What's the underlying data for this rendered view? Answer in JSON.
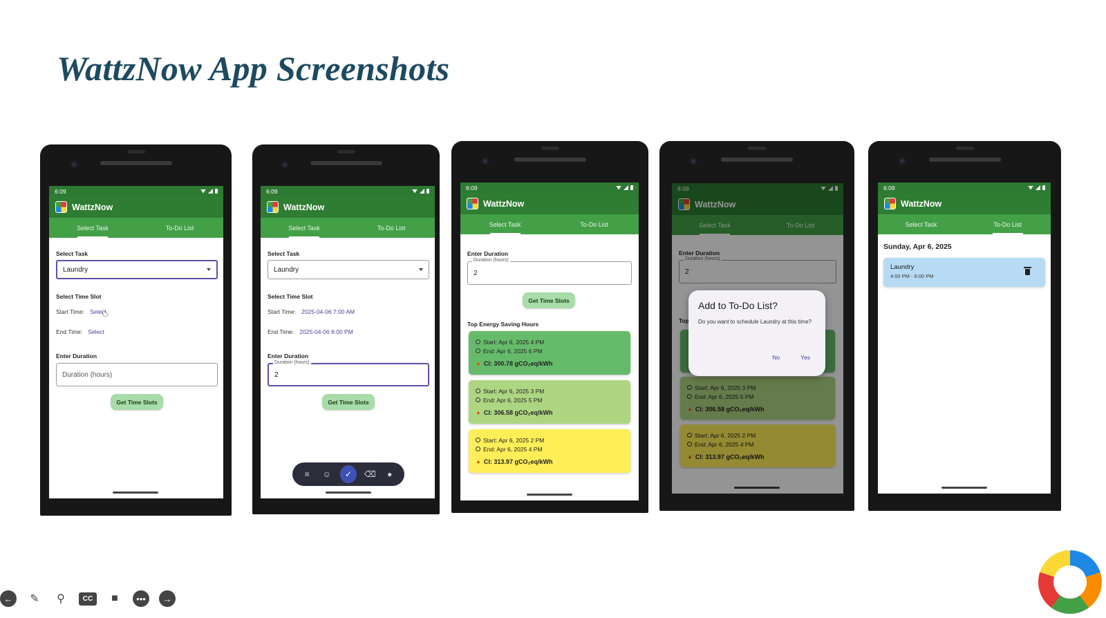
{
  "slide": {
    "title": "WattzNow App Screenshots"
  },
  "app": {
    "status_time": "6:09",
    "name": "WattzNow",
    "tab_select": "Select Task",
    "tab_todo": "To-Do List"
  },
  "screen1": {
    "select_task_label": "Select Task",
    "task_value": "Laundry",
    "time_slot_label": "Select Time Slot",
    "start_label": "Start Time:",
    "start_value": "Select",
    "end_label": "End Time:",
    "end_value": "Select",
    "duration_label": "Enter Duration",
    "duration_placeholder": "Duration (hours)",
    "button": "Get Time Slots"
  },
  "screen2": {
    "select_task_label": "Select Task",
    "task_value": "Laundry",
    "time_slot_label": "Select Time Slot",
    "start_label": "Start Time:",
    "start_value": "2025-04-06 7:00 AM",
    "end_label": "End Time:",
    "end_value": "2025-04-06 6:00 PM",
    "duration_label": "Enter Duration",
    "duration_legend": "Duration (hours)",
    "duration_value": "2",
    "button": "Get Time Slots"
  },
  "screen3": {
    "duration_label": "Enter Duration",
    "duration_legend": "Duration (hours)",
    "duration_value": "2",
    "button": "Get Time Slots",
    "results_label": "Top Energy Saving Hours",
    "slots": [
      {
        "start": "Start: Apr 6, 2025 4 PM",
        "end": "End:   Apr 6, 2025 6 PM",
        "ci": "CI: 300.78 gCO₂eq/kWh",
        "color": "#66bb6a"
      },
      {
        "start": "Start: Apr 6, 2025 3 PM",
        "end": "End:   Apr 6, 2025 5 PM",
        "ci": "CI: 306.58 gCO₂eq/kWh",
        "color": "#aed581"
      },
      {
        "start": "Start: Apr 6, 2025 2 PM",
        "end": "End:   Apr 6, 2025 4 PM",
        "ci": "CI: 313.97 gCO₂eq/kWh",
        "color": "#ffee58"
      }
    ]
  },
  "screen4": {
    "duration_label": "Enter Duration",
    "duration_legend": "Duration (hours)",
    "duration_value": "2",
    "results_label_partial": "Top",
    "dialog_title": "Add to To-Do List?",
    "dialog_message": "Do you want to schedule Laundry at this time?",
    "dialog_no": "No",
    "dialog_yes": "Yes",
    "slots": [
      {
        "start": "Start: Apr 6, 2025 3 PM",
        "end": "End:   Apr 6, 2025 5 PM",
        "ci": "CI: 306.58 gCO₂eq/kWh"
      },
      {
        "start": "Start: Apr 6, 2025 2 PM",
        "end": "End:   Apr 6, 2025 4 PM",
        "ci": "CI: 313.97 gCO₂eq/kWh"
      }
    ]
  },
  "screen5": {
    "date_heading": "Sunday, Apr 6, 2025",
    "item_title": "Laundry",
    "item_time": "4:00 PM - 6:00 PM"
  },
  "presenter_icons": [
    "back-arrow-icon",
    "pen-icon",
    "search-icon",
    "cc-icon",
    "video-icon",
    "more-icon",
    "forward-arrow-icon"
  ]
}
